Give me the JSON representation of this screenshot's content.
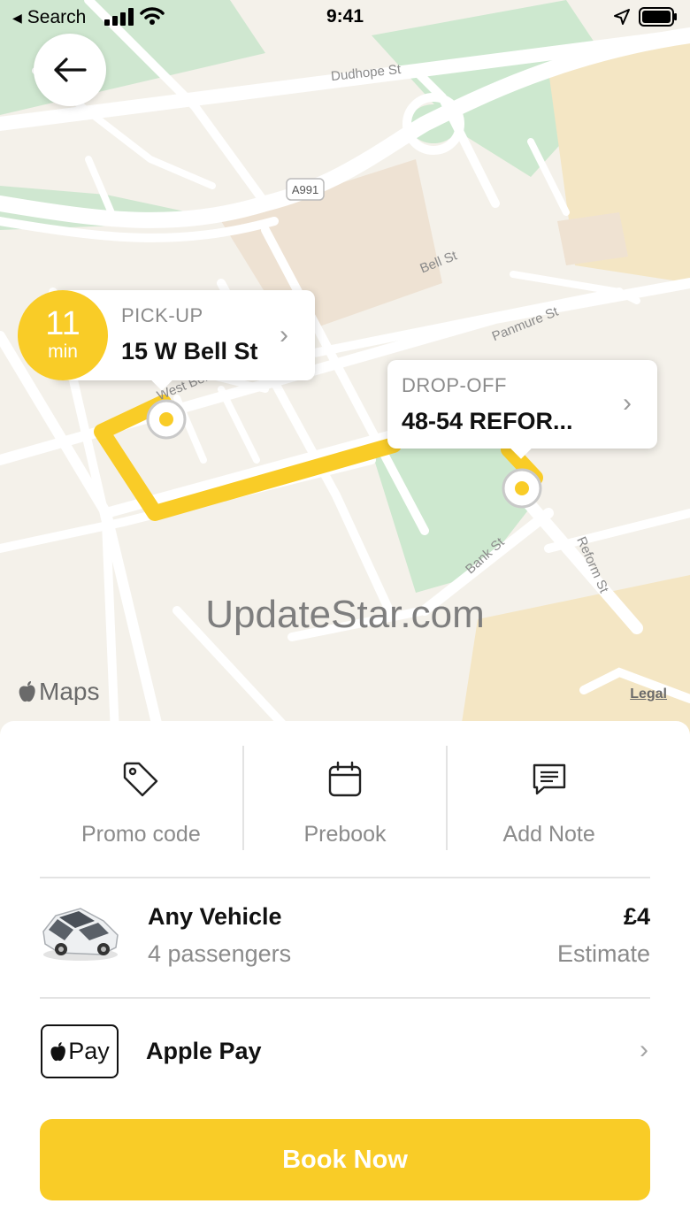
{
  "status_bar": {
    "back_app": "Search",
    "time": "9:41"
  },
  "map": {
    "streets": [
      "Dudhope St",
      "A991",
      "Bell St",
      "Panmure St",
      "West Bell",
      "Bank St",
      "Reform St"
    ],
    "watermark": "UpdateStar.com",
    "maps_brand": "Maps",
    "legal": "Legal"
  },
  "eta": {
    "value": "11",
    "unit": "min"
  },
  "pickup": {
    "label": "PICK-UP",
    "address": "15 W Bell St"
  },
  "dropoff": {
    "label": "DROP-OFF",
    "address": "48-54 REFOR..."
  },
  "actions": [
    {
      "label": "Promo code",
      "icon": "tag-icon"
    },
    {
      "label": "Prebook",
      "icon": "calendar-icon"
    },
    {
      "label": "Add Note",
      "icon": "message-icon"
    }
  ],
  "vehicle": {
    "name": "Any Vehicle",
    "passengers": "4 passengers",
    "price": "£4",
    "price_note": "Estimate"
  },
  "payment": {
    "badge": "Pay",
    "method": "Apple Pay"
  },
  "book_button": "Book Now",
  "colors": {
    "accent": "#f9cc27",
    "park": "#cde8cf",
    "map_bg": "#f4f1ea"
  }
}
